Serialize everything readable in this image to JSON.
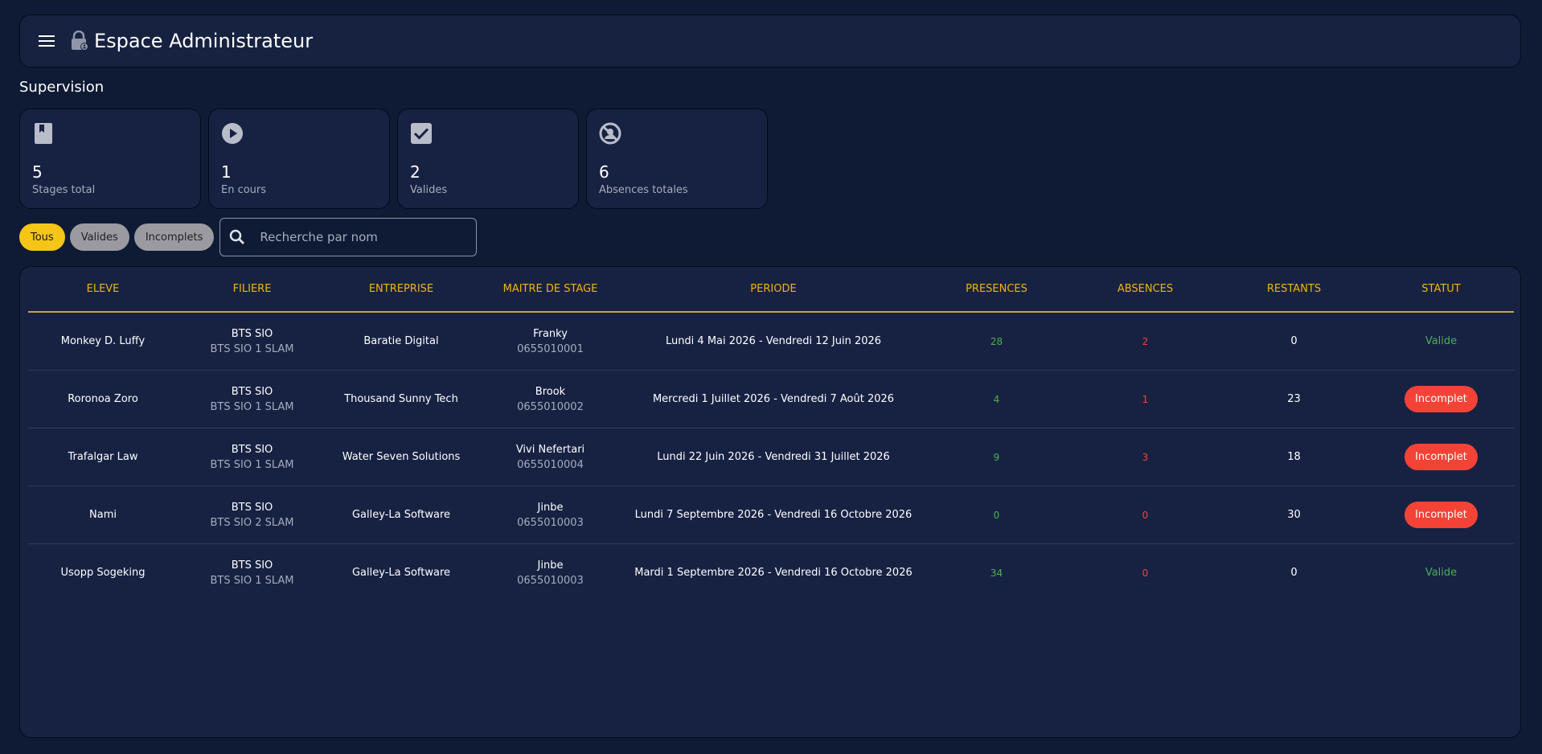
{
  "header": {
    "title": "Espace Administrateur",
    "menu_icon": "menu-icon",
    "lock_icon": "admin-lock-icon"
  },
  "supervision": {
    "title": "Supervision",
    "cards": [
      {
        "icon": "book-bookmark-icon",
        "value": "5",
        "label": "Stages total"
      },
      {
        "icon": "play-circle-icon",
        "value": "1",
        "label": "En cours"
      },
      {
        "icon": "checkbox-icon",
        "value": "2",
        "label": "Valides"
      },
      {
        "icon": "blocked-icon",
        "value": "6",
        "label": "Absences totales"
      }
    ]
  },
  "filters": {
    "chips": [
      {
        "label": "Tous",
        "active": true
      },
      {
        "label": "Valides",
        "active": false
      },
      {
        "label": "Incomplets",
        "active": false
      }
    ],
    "search": {
      "placeholder": "Recherche par nom",
      "value": ""
    }
  },
  "table": {
    "headers": [
      "ELEVE",
      "FILIERE",
      "ENTREPRISE",
      "MAITRE DE STAGE",
      "PERIODE",
      "PRESENCES",
      "ABSENCES",
      "RESTANTS",
      "STATUT"
    ],
    "rows": [
      {
        "eleve": "Monkey D. Luffy",
        "filiere": "BTS SIO",
        "classe": "BTS SIO 1 SLAM",
        "entreprise": "Baratie Digital",
        "maitre": "Franky",
        "tel": "0655010001",
        "periode": "Lundi 4 Mai 2026 - Vendredi 12 Juin 2026",
        "presences": "28",
        "absences": "2",
        "restants": "0",
        "statut": "Valide"
      },
      {
        "eleve": "Roronoa Zoro",
        "filiere": "BTS SIO",
        "classe": "BTS SIO 1 SLAM",
        "entreprise": "Thousand Sunny Tech",
        "maitre": "Brook",
        "tel": "0655010002",
        "periode": "Mercredi 1 Juillet 2026 - Vendredi 7 Août 2026",
        "presences": "4",
        "absences": "1",
        "restants": "23",
        "statut": "Incomplet"
      },
      {
        "eleve": "Trafalgar Law",
        "filiere": "BTS SIO",
        "classe": "BTS SIO 1 SLAM",
        "entreprise": "Water Seven Solutions",
        "maitre": "Vivi Nefertari",
        "tel": "0655010004",
        "periode": "Lundi 22 Juin 2026 - Vendredi 31 Juillet 2026",
        "presences": "9",
        "absences": "3",
        "restants": "18",
        "statut": "Incomplet"
      },
      {
        "eleve": "Nami",
        "filiere": "BTS SIO",
        "classe": "BTS SIO 2 SLAM",
        "entreprise": "Galley-La Software",
        "maitre": "Jinbe",
        "tel": "0655010003",
        "periode": "Lundi 7 Septembre 2026 - Vendredi 16 Octobre 2026",
        "presences": "0",
        "absences": "0",
        "restants": "30",
        "statut": "Incomplet"
      },
      {
        "eleve": "Usopp Sogeking",
        "filiere": "BTS SIO",
        "classe": "BTS SIO 1 SLAM",
        "entreprise": "Galley-La Software",
        "maitre": "Jinbe",
        "tel": "0655010003",
        "periode": "Mardi 1 Septembre 2026 - Vendredi 16 Octobre 2026",
        "presences": "34",
        "absences": "0",
        "restants": "0",
        "statut": "Valide"
      }
    ]
  },
  "colors": {
    "accent": "#f5c518",
    "header_text": "#f5b30a",
    "success": "#4caf50",
    "danger": "#f44336",
    "background": "#0f1b34",
    "surface": "#172243"
  }
}
